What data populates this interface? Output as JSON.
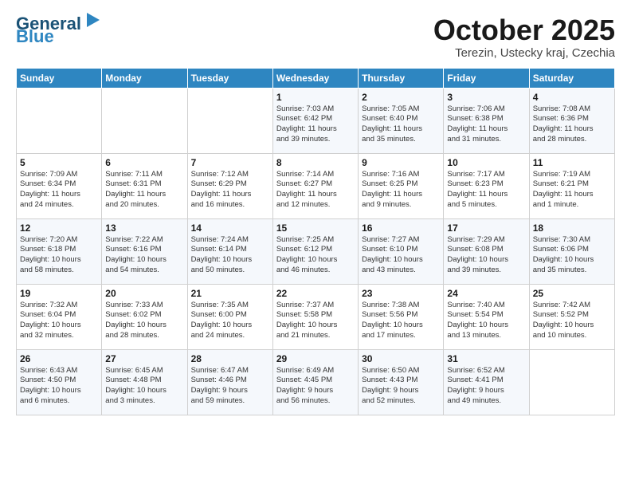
{
  "logo": {
    "line1": "General",
    "line2": "Blue"
  },
  "title": "October 2025",
  "subtitle": "Terezin, Ustecky kraj, Czechia",
  "header": {
    "days": [
      "Sunday",
      "Monday",
      "Tuesday",
      "Wednesday",
      "Thursday",
      "Friday",
      "Saturday"
    ]
  },
  "weeks": [
    [
      {
        "day": "",
        "info": ""
      },
      {
        "day": "",
        "info": ""
      },
      {
        "day": "",
        "info": ""
      },
      {
        "day": "1",
        "info": "Sunrise: 7:03 AM\nSunset: 6:42 PM\nDaylight: 11 hours\nand 39 minutes."
      },
      {
        "day": "2",
        "info": "Sunrise: 7:05 AM\nSunset: 6:40 PM\nDaylight: 11 hours\nand 35 minutes."
      },
      {
        "day": "3",
        "info": "Sunrise: 7:06 AM\nSunset: 6:38 PM\nDaylight: 11 hours\nand 31 minutes."
      },
      {
        "day": "4",
        "info": "Sunrise: 7:08 AM\nSunset: 6:36 PM\nDaylight: 11 hours\nand 28 minutes."
      }
    ],
    [
      {
        "day": "5",
        "info": "Sunrise: 7:09 AM\nSunset: 6:34 PM\nDaylight: 11 hours\nand 24 minutes."
      },
      {
        "day": "6",
        "info": "Sunrise: 7:11 AM\nSunset: 6:31 PM\nDaylight: 11 hours\nand 20 minutes."
      },
      {
        "day": "7",
        "info": "Sunrise: 7:12 AM\nSunset: 6:29 PM\nDaylight: 11 hours\nand 16 minutes."
      },
      {
        "day": "8",
        "info": "Sunrise: 7:14 AM\nSunset: 6:27 PM\nDaylight: 11 hours\nand 12 minutes."
      },
      {
        "day": "9",
        "info": "Sunrise: 7:16 AM\nSunset: 6:25 PM\nDaylight: 11 hours\nand 9 minutes."
      },
      {
        "day": "10",
        "info": "Sunrise: 7:17 AM\nSunset: 6:23 PM\nDaylight: 11 hours\nand 5 minutes."
      },
      {
        "day": "11",
        "info": "Sunrise: 7:19 AM\nSunset: 6:21 PM\nDaylight: 11 hours\nand 1 minute."
      }
    ],
    [
      {
        "day": "12",
        "info": "Sunrise: 7:20 AM\nSunset: 6:18 PM\nDaylight: 10 hours\nand 58 minutes."
      },
      {
        "day": "13",
        "info": "Sunrise: 7:22 AM\nSunset: 6:16 PM\nDaylight: 10 hours\nand 54 minutes."
      },
      {
        "day": "14",
        "info": "Sunrise: 7:24 AM\nSunset: 6:14 PM\nDaylight: 10 hours\nand 50 minutes."
      },
      {
        "day": "15",
        "info": "Sunrise: 7:25 AM\nSunset: 6:12 PM\nDaylight: 10 hours\nand 46 minutes."
      },
      {
        "day": "16",
        "info": "Sunrise: 7:27 AM\nSunset: 6:10 PM\nDaylight: 10 hours\nand 43 minutes."
      },
      {
        "day": "17",
        "info": "Sunrise: 7:29 AM\nSunset: 6:08 PM\nDaylight: 10 hours\nand 39 minutes."
      },
      {
        "day": "18",
        "info": "Sunrise: 7:30 AM\nSunset: 6:06 PM\nDaylight: 10 hours\nand 35 minutes."
      }
    ],
    [
      {
        "day": "19",
        "info": "Sunrise: 7:32 AM\nSunset: 6:04 PM\nDaylight: 10 hours\nand 32 minutes."
      },
      {
        "day": "20",
        "info": "Sunrise: 7:33 AM\nSunset: 6:02 PM\nDaylight: 10 hours\nand 28 minutes."
      },
      {
        "day": "21",
        "info": "Sunrise: 7:35 AM\nSunset: 6:00 PM\nDaylight: 10 hours\nand 24 minutes."
      },
      {
        "day": "22",
        "info": "Sunrise: 7:37 AM\nSunset: 5:58 PM\nDaylight: 10 hours\nand 21 minutes."
      },
      {
        "day": "23",
        "info": "Sunrise: 7:38 AM\nSunset: 5:56 PM\nDaylight: 10 hours\nand 17 minutes."
      },
      {
        "day": "24",
        "info": "Sunrise: 7:40 AM\nSunset: 5:54 PM\nDaylight: 10 hours\nand 13 minutes."
      },
      {
        "day": "25",
        "info": "Sunrise: 7:42 AM\nSunset: 5:52 PM\nDaylight: 10 hours\nand 10 minutes."
      }
    ],
    [
      {
        "day": "26",
        "info": "Sunrise: 6:43 AM\nSunset: 4:50 PM\nDaylight: 10 hours\nand 6 minutes."
      },
      {
        "day": "27",
        "info": "Sunrise: 6:45 AM\nSunset: 4:48 PM\nDaylight: 10 hours\nand 3 minutes."
      },
      {
        "day": "28",
        "info": "Sunrise: 6:47 AM\nSunset: 4:46 PM\nDaylight: 9 hours\nand 59 minutes."
      },
      {
        "day": "29",
        "info": "Sunrise: 6:49 AM\nSunset: 4:45 PM\nDaylight: 9 hours\nand 56 minutes."
      },
      {
        "day": "30",
        "info": "Sunrise: 6:50 AM\nSunset: 4:43 PM\nDaylight: 9 hours\nand 52 minutes."
      },
      {
        "day": "31",
        "info": "Sunrise: 6:52 AM\nSunset: 4:41 PM\nDaylight: 9 hours\nand 49 minutes."
      },
      {
        "day": "",
        "info": ""
      }
    ]
  ]
}
